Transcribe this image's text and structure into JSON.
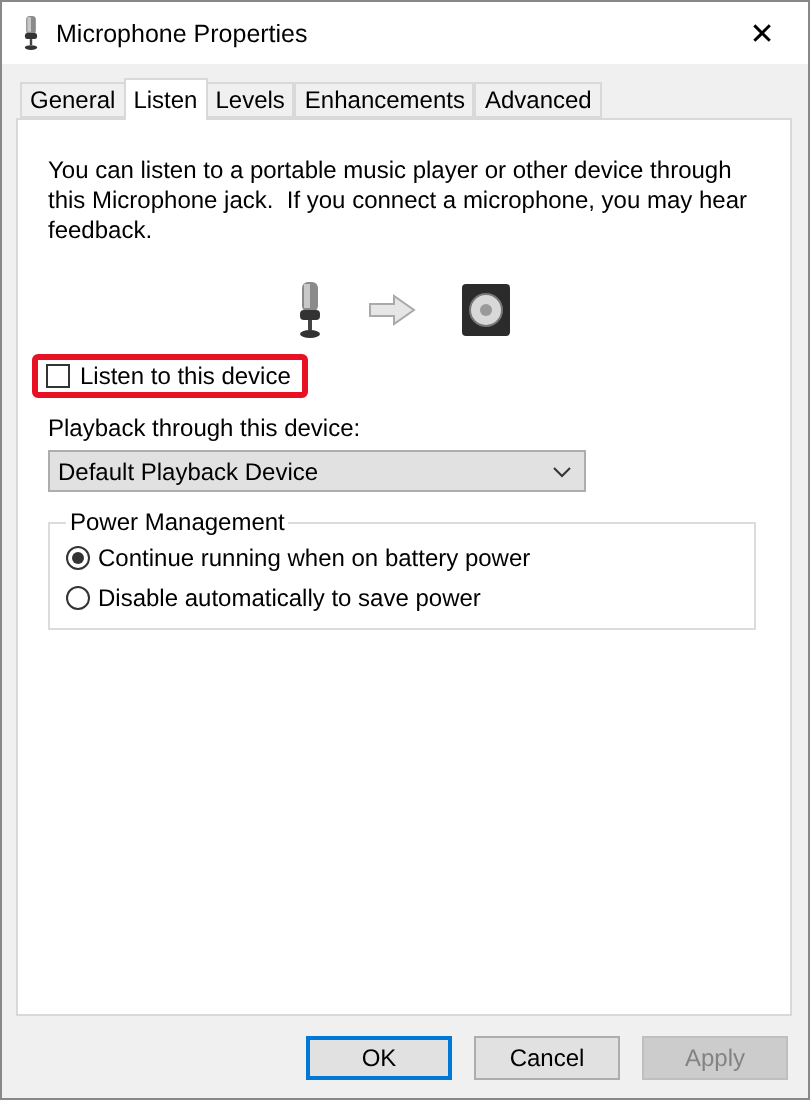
{
  "window": {
    "title": "Microphone Properties",
    "close": "✕"
  },
  "tabs": [
    {
      "label": "General",
      "selected": false
    },
    {
      "label": "Listen",
      "selected": true
    },
    {
      "label": "Levels",
      "selected": false
    },
    {
      "label": "Enhancements",
      "selected": false
    },
    {
      "label": "Advanced",
      "selected": false
    }
  ],
  "description": "You can listen to a portable music player or other device through this Microphone jack.  If you connect a microphone, you may hear feedback.",
  "listen_checkbox": {
    "label": "Listen to this device",
    "checked": false,
    "highlighted": true
  },
  "playback": {
    "label": "Playback through this device:",
    "value": "Default Playback Device"
  },
  "power_management": {
    "title": "Power Management",
    "options": [
      {
        "label": "Continue running when on battery power",
        "selected": true
      },
      {
        "label": "Disable automatically to save power",
        "selected": false
      }
    ]
  },
  "buttons": [
    {
      "label": "OK",
      "default": true,
      "disabled": false
    },
    {
      "label": "Cancel",
      "default": false,
      "disabled": false
    },
    {
      "label": "Apply",
      "default": false,
      "disabled": true
    }
  ]
}
